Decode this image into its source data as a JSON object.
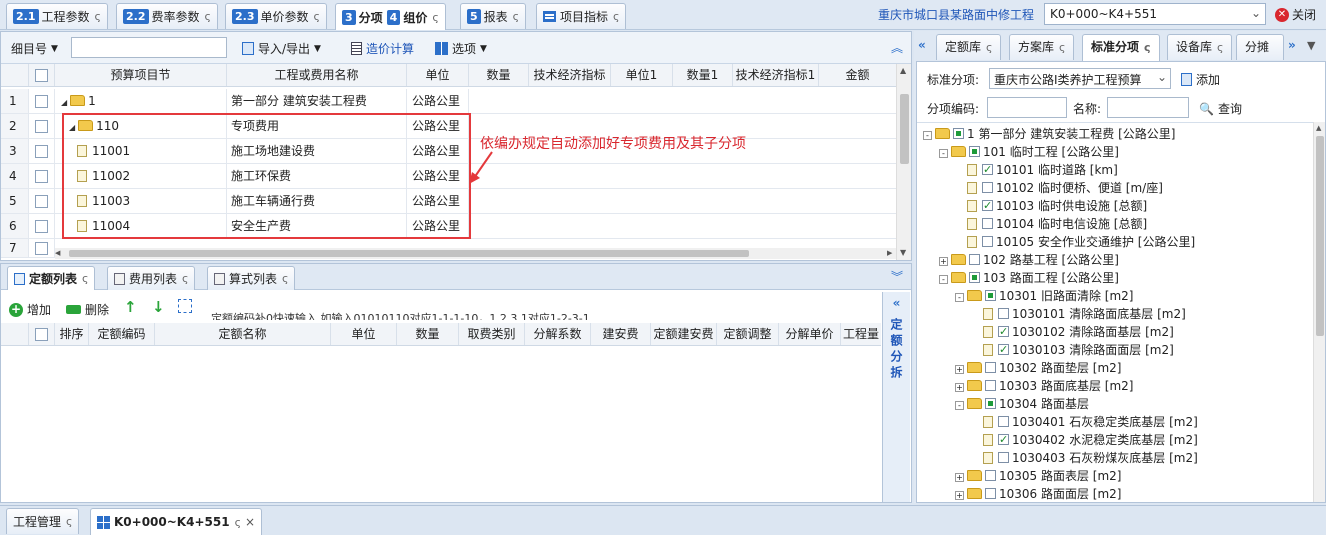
{
  "top_tabs": [
    {
      "num": "2.1",
      "label": "工程参数"
    },
    {
      "num": "2.2",
      "label": "费率参数"
    },
    {
      "num": "2.3",
      "label": "单价参数"
    },
    {
      "num": "3",
      "label": "分项",
      "num2": "4",
      "label2": "组价"
    },
    {
      "num": "5",
      "label": "报表"
    },
    {
      "label": "项目指标"
    }
  ],
  "refresh_glyph": "ς",
  "project_name": "重庆市城口县某路面中修工程",
  "stake_range": "K0+000~K4+551",
  "close_label": "关闭",
  "toolbar": {
    "item_label": "细目号",
    "import_export": "导入/导出",
    "calc": "造价计算",
    "options": "选项"
  },
  "grid": {
    "headers": [
      "预算项目节",
      "工程或费用名称",
      "单位",
      "数量",
      "技术经济指标",
      "单位1",
      "数量1",
      "技术经济指标1",
      "金额"
    ],
    "rows": [
      {
        "n": "1",
        "code": "1",
        "name": "第一部分 建筑安装工程费",
        "unit": "公路公里",
        "kind": "folder",
        "level": 0
      },
      {
        "n": "2",
        "code": "110",
        "name": "专项费用",
        "unit": "公路公里",
        "kind": "folder",
        "level": 1
      },
      {
        "n": "3",
        "code": "11001",
        "name": "施工场地建设费",
        "unit": "公路公里",
        "kind": "doc",
        "level": 2
      },
      {
        "n": "4",
        "code": "11002",
        "name": "施工环保费",
        "unit": "公路公里",
        "kind": "doc",
        "level": 2
      },
      {
        "n": "5",
        "code": "11003",
        "name": "施工车辆通行费",
        "unit": "公路公里",
        "kind": "doc",
        "level": 2
      },
      {
        "n": "6",
        "code": "11004",
        "name": "安全生产费",
        "unit": "公路公里",
        "kind": "doc",
        "level": 2
      },
      {
        "n": "7",
        "code": "",
        "name": "",
        "unit": "",
        "kind": "",
        "level": 0
      }
    ]
  },
  "annotation": "依编办规定自动添加好专项费用及其子分项",
  "bottom_tabs": [
    "定额列表",
    "费用列表",
    "算式列表"
  ],
  "bottom_toolbar": {
    "add": "增加",
    "delete": "删除",
    "hint": "定额编码补0快速输入 如输入01010110对应1-1-1-10，1.2.3.1对应1-2-3-1."
  },
  "quota_headers": [
    "排序",
    "定额编码",
    "定额名称",
    "单位",
    "数量",
    "取费类别",
    "分解系数",
    "建安费",
    "定额建安费",
    "定额调整",
    "分解单价",
    "工程量"
  ],
  "side_label": "定额分拆",
  "right_tabs": [
    "定额库",
    "方案库",
    "标准分项",
    "设备库",
    "分摊"
  ],
  "right_form": {
    "std_label": "标准分项:",
    "std_value": "重庆市公路Ⅰ类养护工程预算",
    "add": "添加",
    "code_label": "分项编码:",
    "name_label": "名称:",
    "query": "查询"
  },
  "tree": [
    {
      "level": 0,
      "exp": "-",
      "cb": "part",
      "text": "1 第一部分 建筑安装工程费 [公路公里]",
      "icon": "folder"
    },
    {
      "level": 1,
      "exp": "-",
      "cb": "part",
      "text": "101 临时工程 [公路公里]",
      "icon": "folder"
    },
    {
      "level": 2,
      "exp": "",
      "cb": "on",
      "text": "10101 临时道路 [km]",
      "icon": "doc"
    },
    {
      "level": 2,
      "exp": "",
      "cb": "off",
      "text": "10102 临时便桥、便道 [m/座]",
      "icon": "doc"
    },
    {
      "level": 2,
      "exp": "",
      "cb": "on",
      "text": "10103 临时供电设施 [总额]",
      "icon": "doc"
    },
    {
      "level": 2,
      "exp": "",
      "cb": "off",
      "text": "10104 临时电信设施 [总额]",
      "icon": "doc"
    },
    {
      "level": 2,
      "exp": "",
      "cb": "off",
      "text": "10105 安全作业交通维护 [公路公里]",
      "icon": "doc"
    },
    {
      "level": 1,
      "exp": "+",
      "cb": "off",
      "text": "102 路基工程 [公路公里]",
      "icon": "folder"
    },
    {
      "level": 1,
      "exp": "-",
      "cb": "part",
      "text": "103 路面工程 [公路公里]",
      "icon": "folder"
    },
    {
      "level": 2,
      "exp": "-",
      "cb": "part",
      "text": "10301 旧路面清除 [m2]",
      "icon": "folder"
    },
    {
      "level": 3,
      "exp": "",
      "cb": "off",
      "text": "1030101 清除路面底基层 [m2]",
      "icon": "doc"
    },
    {
      "level": 3,
      "exp": "",
      "cb": "on",
      "text": "1030102 清除路面基层 [m2]",
      "icon": "doc"
    },
    {
      "level": 3,
      "exp": "",
      "cb": "on",
      "text": "1030103 清除路面面层 [m2]",
      "icon": "doc"
    },
    {
      "level": 2,
      "exp": "+",
      "cb": "off",
      "text": "10302 路面垫层 [m2]",
      "icon": "folder"
    },
    {
      "level": 2,
      "exp": "+",
      "cb": "off",
      "text": "10303 路面底基层 [m2]",
      "icon": "folder"
    },
    {
      "level": 2,
      "exp": "-",
      "cb": "part",
      "text": "10304 路面基层",
      "icon": "folder"
    },
    {
      "level": 3,
      "exp": "",
      "cb": "off",
      "text": "1030401 石灰稳定类底基层 [m2]",
      "icon": "doc"
    },
    {
      "level": 3,
      "exp": "",
      "cb": "on",
      "text": "1030402 水泥稳定类底基层 [m2]",
      "icon": "doc"
    },
    {
      "level": 3,
      "exp": "",
      "cb": "off",
      "text": "1030403 石灰粉煤灰底基层 [m2]",
      "icon": "doc"
    },
    {
      "level": 2,
      "exp": "+",
      "cb": "off",
      "text": "10305 路面表层 [m2]",
      "icon": "folder"
    },
    {
      "level": 2,
      "exp": "+",
      "cb": "off",
      "text": "10306 路面面层 [m2]",
      "icon": "folder"
    }
  ],
  "status_tabs": [
    {
      "label": "工程管理"
    },
    {
      "label": "K0+000~K4+551"
    }
  ]
}
